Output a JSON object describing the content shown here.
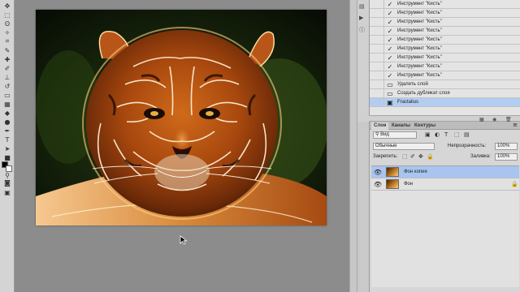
{
  "history": {
    "items": [
      {
        "label": "Инструмент \"Кисть\"",
        "icon": "brush-icon",
        "selected": false
      },
      {
        "label": "Инструмент \"Кисть\"",
        "icon": "brush-icon",
        "selected": false
      },
      {
        "label": "Инструмент \"Кисть\"",
        "icon": "brush-icon",
        "selected": false
      },
      {
        "label": "Инструмент \"Кисть\"",
        "icon": "brush-icon",
        "selected": false
      },
      {
        "label": "Инструмент \"Кисть\"",
        "icon": "brush-icon",
        "selected": false
      },
      {
        "label": "Инструмент \"Кисть\"",
        "icon": "brush-icon",
        "selected": false
      },
      {
        "label": "Инструмент \"Кисть\"",
        "icon": "brush-icon",
        "selected": false
      },
      {
        "label": "Инструмент \"Кисть\"",
        "icon": "brush-icon",
        "selected": false
      },
      {
        "label": "Инструмент \"Кисть\"",
        "icon": "brush-icon",
        "selected": false
      },
      {
        "label": "Удалить слой",
        "icon": "layer-delete-icon",
        "selected": false
      },
      {
        "label": "Создать дубликат слоя",
        "icon": "layer-duplicate-icon",
        "selected": false
      },
      {
        "label": "Fractalius",
        "icon": "filter-icon",
        "selected": true
      }
    ]
  },
  "layers_panel": {
    "tabs": [
      "Слои",
      "Каналы",
      "Контуры"
    ],
    "active_tab": "Слои",
    "filter_kind": "Вид",
    "blend_mode": "Обычные",
    "opacity_label": "Непрозрачность:",
    "opacity_value": "100%",
    "lock_label": "Закрепить:",
    "fill_label": "Заливка:",
    "fill_value": "100%",
    "layers": [
      {
        "name": "Фон копия",
        "selected": true,
        "visible": true,
        "locked": false
      },
      {
        "name": "Фон",
        "selected": false,
        "visible": true,
        "locked": true
      }
    ]
  },
  "colors": {
    "accent_selection": "#b3cdf0",
    "foreground_swatch": "#000000",
    "background_swatch": "#ffffff"
  }
}
